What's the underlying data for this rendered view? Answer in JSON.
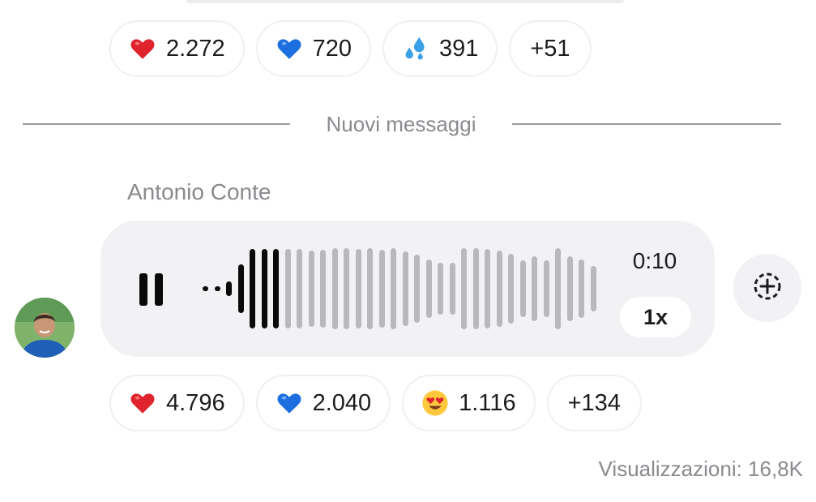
{
  "top_reactions": [
    {
      "icon": "red-heart-icon",
      "count": "2.272"
    },
    {
      "icon": "blue-heart-icon",
      "count": "720"
    },
    {
      "icon": "sweat-droplets-icon",
      "count": "391"
    },
    {
      "more": "+51"
    }
  ],
  "divider": {
    "label": "Nuovi messaggi"
  },
  "message": {
    "sender": "Antonio Conte",
    "avatar_icon": "avatar-photo",
    "voice": {
      "state_icon": "pause-icon",
      "duration": "0:10",
      "speed": "1x",
      "progress": 0.22,
      "played_color": "#0a0a0a",
      "unplayed_color": "#b9b9bd"
    },
    "add_reaction_icon": "add-reaction-icon"
  },
  "bottom_reactions": [
    {
      "icon": "red-heart-icon",
      "count": "4.796"
    },
    {
      "icon": "blue-heart-icon",
      "count": "2.040"
    },
    {
      "icon": "heart-eyes-icon",
      "count": "1.116"
    },
    {
      "more": "+134"
    }
  ],
  "views": {
    "text": "Visualizzazioni: 16,8K"
  }
}
